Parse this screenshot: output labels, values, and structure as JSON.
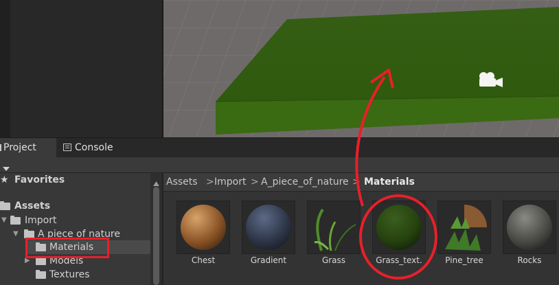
{
  "tabs": {
    "project": "Project",
    "console": "Console"
  },
  "favorites": {
    "label": "Favorites"
  },
  "tree": {
    "assets": "Assets",
    "import": "Import",
    "a_piece": "A piece of nature",
    "materials": "Materials",
    "models": "Models",
    "textures": "Textures"
  },
  "breadcrumb": [
    "Assets",
    "Import",
    "A_piece_of_nature",
    "Materials"
  ],
  "breadcrumb_separator": ">",
  "assets": [
    {
      "name": "Chest",
      "icon": "wood-sphere-icon"
    },
    {
      "name": "Gradient",
      "icon": "dark-blue-sphere-icon"
    },
    {
      "name": "Grass",
      "icon": "grass-blades-icon"
    },
    {
      "name": "Grass_text.",
      "icon": "green-sphere-icon"
    },
    {
      "name": "Pine_tree",
      "icon": "pine-sphere-icon"
    },
    {
      "name": "Rocks",
      "icon": "rock-sphere-icon"
    }
  ],
  "annotation_colors": {
    "highlight": "#e8202a"
  },
  "scene": {
    "camera_icon": "camera-icon"
  }
}
